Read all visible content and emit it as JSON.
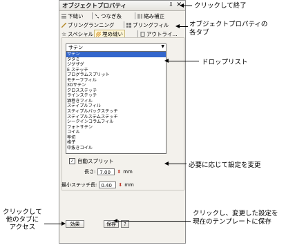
{
  "panel": {
    "title": "オブジェクトプロパティ",
    "pin_glyph": "⇩",
    "close_glyph": "×"
  },
  "tabs_row1": [
    {
      "label": "下縫い",
      "icon": "underlay-icon"
    },
    {
      "label": "つなぎ糸",
      "icon": "connector-icon"
    },
    {
      "label": "縮み補正",
      "icon": "pull-comp-icon"
    }
  ],
  "tabs_row2": [
    {
      "label": "ブリングランニング",
      "icon": "running-icon"
    },
    {
      "label": "ブリングフィル",
      "icon": "fill-icon"
    }
  ],
  "tabs_row3": [
    {
      "label": "スペシャル",
      "icon": "star-icon"
    },
    {
      "label": "埋め縫い",
      "icon": "fill-stitch-icon",
      "active": true
    },
    {
      "label": "アウトライ...",
      "icon": "outline-icon"
    }
  ],
  "combo": {
    "value": "サテン"
  },
  "dropdown_items": [
    "サテン",
    "タタミ",
    "ジグザグ",
    "E ステッチ",
    "プログラムスプリット",
    "モチーフフィル",
    "3Dサテン",
    "クロスステッチ",
    "ラインステッチ",
    "酒巻きフィル",
    "スティプルフィル",
    "スティプルバックステッチ",
    "スティプルステムステッチ",
    "シークインコラムフィル",
    "フォトサテン",
    "コイル",
    "率切",
    "格子",
    "中抜きコイル"
  ],
  "dropdown_selected_index": 0,
  "auto_split": {
    "label": "自動スプリット",
    "checked": true
  },
  "length": {
    "label": "長さ:",
    "value": "7.00",
    "unit": "mm"
  },
  "min_stitch": {
    "label": "最小ステッチ長:",
    "value": "0.40",
    "unit": "mm"
  },
  "buttons": {
    "effects": "効果",
    "save": "保存",
    "help": "?"
  },
  "annotations": {
    "close": "クリックして終了",
    "tabs": "オブジェクトプロパティの\n各タブ",
    "dropdown": "ドロップリスト",
    "settings": "必要に応じて設定を変更",
    "other_tabs": "クリックして\n他のタブに\nアクセス",
    "save": "クリックし、変更した設定を\n現在のテンプレートに保存"
  }
}
